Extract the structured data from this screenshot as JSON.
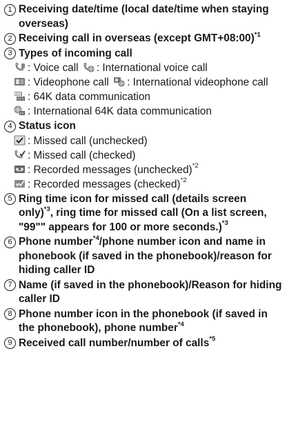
{
  "items": [
    {
      "number": "1",
      "text": "Receiving date/time (local date/time when staying overseas)"
    },
    {
      "number": "2",
      "text": "Receiving call in overseas (except GMT+08:00)",
      "footnote": "*1"
    },
    {
      "number": "3",
      "text": "Types of incoming call",
      "icons": [
        {
          "icon": "voice-call-icon",
          "label": ": Voice call"
        },
        {
          "icon": "international-voice-call-icon",
          "label": ": International voice call"
        },
        {
          "icon": "videophone-call-icon",
          "label": ": Videophone call"
        },
        {
          "icon": "international-videophone-call-icon",
          "label": ": International videophone call"
        },
        {
          "icon": "64k-data-communication-icon",
          "label": ": 64K data communication"
        },
        {
          "icon": "international-64k-data-communication-icon",
          "label": ": International 64K data communication"
        }
      ]
    },
    {
      "number": "4",
      "text": "Status icon",
      "icons": [
        {
          "icon": "missed-call-unchecked-icon",
          "label": ": Missed call (unchecked)"
        },
        {
          "icon": "missed-call-checked-icon",
          "label": ": Missed call (checked)"
        },
        {
          "icon": "recorded-messages-unchecked-icon",
          "label": ": Recorded messages (unchecked)",
          "footnote": "*2"
        },
        {
          "icon": "recorded-messages-checked-icon",
          "label": ": Recorded messages (checked)",
          "footnote": "*2"
        }
      ]
    },
    {
      "number": "5",
      "text_a": "Ring time icon for missed call (details screen only)",
      "footnote_a": "*3",
      "text_b": ", ring time for missed call (On a list screen, \"99\"\" appears for 100 or more seconds.)",
      "footnote_b": "*3"
    },
    {
      "number": "6",
      "text_a": "Phone number",
      "footnote_a": "*4",
      "text_b": "/phone number icon and name in phonebook (if saved in the phonebook)/reason for hiding caller ID"
    },
    {
      "number": "7",
      "text": "Name (if saved in the phonebook)/Reason for hiding caller ID"
    },
    {
      "number": "8",
      "text": "Phone number icon in the phonebook (if saved in the phonebook), phone number",
      "footnote": "*4"
    },
    {
      "number": "9",
      "text": "Received call number/number of calls",
      "footnote": "*5"
    }
  ]
}
